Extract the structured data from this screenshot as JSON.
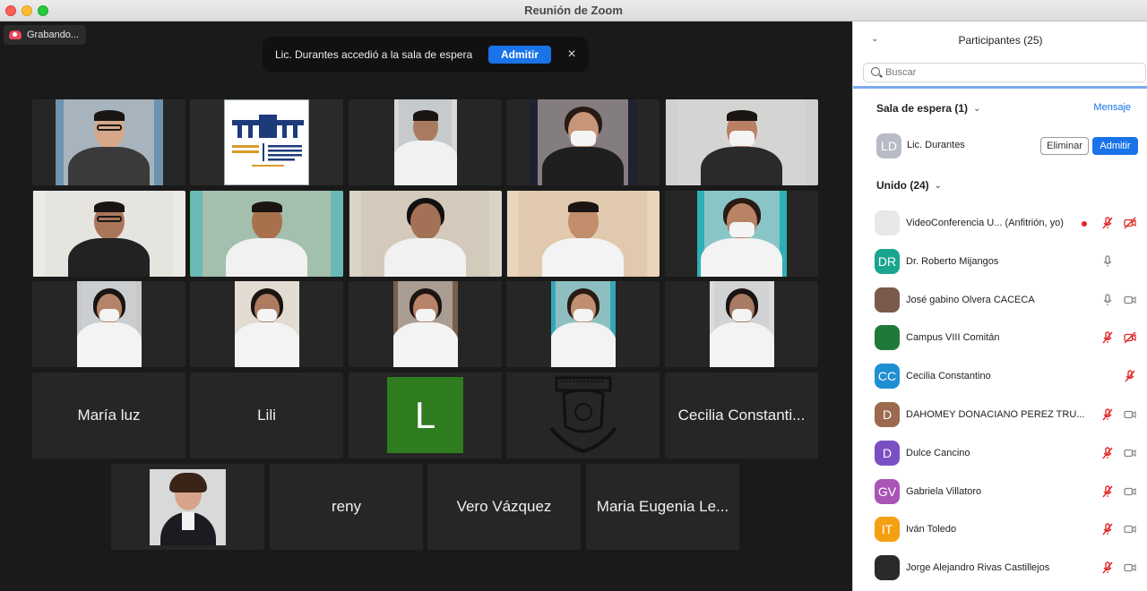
{
  "window": {
    "title": "Reunión de Zoom"
  },
  "recording": {
    "label": "Grabando..."
  },
  "banner": {
    "message": "Lic. Durantes accedió a la sala de espera",
    "admit_label": "Admitir",
    "close_icon": "×"
  },
  "tiles": [
    {
      "kind": "video",
      "label": ""
    },
    {
      "kind": "logo",
      "label": "FACULTAD DE CIENCIAS ADMINISTRATIVAS CAMPUS VIII"
    },
    {
      "kind": "video",
      "label": ""
    },
    {
      "kind": "video",
      "label": ""
    },
    {
      "kind": "video",
      "label": ""
    },
    {
      "kind": "video",
      "label": ""
    },
    {
      "kind": "video",
      "label": "",
      "active": true
    },
    {
      "kind": "video",
      "label": ""
    },
    {
      "kind": "video",
      "label": ""
    },
    {
      "kind": "video",
      "label": ""
    },
    {
      "kind": "video",
      "label": ""
    },
    {
      "kind": "video",
      "label": ""
    },
    {
      "kind": "video",
      "label": ""
    },
    {
      "kind": "video",
      "label": ""
    },
    {
      "kind": "video",
      "label": ""
    },
    {
      "kind": "name",
      "label": "María luz"
    },
    {
      "kind": "name",
      "label": "Lili"
    },
    {
      "kind": "letter",
      "label": "L"
    },
    {
      "kind": "logo2",
      "label": ""
    },
    {
      "kind": "name",
      "label": "Cecilia Constanti..."
    },
    {
      "kind": "photo",
      "label": ""
    },
    {
      "kind": "name",
      "label": "reny"
    },
    {
      "kind": "name",
      "label": "Vero Vázquez"
    },
    {
      "kind": "name",
      "label": "Maria Eugenia Le..."
    }
  ],
  "panel": {
    "title": "Participantes (25)",
    "search_placeholder": "Buscar",
    "waiting_section": "Sala de espera (1)",
    "message_link": "Mensaje",
    "waiting": {
      "initials": "LD",
      "name": "Lic. Durantes",
      "remove_label": "Eliminar",
      "admit_label": "Admitir"
    },
    "joined_section": "Unido (24)",
    "participants": [
      {
        "initials": "",
        "name": "VideoConferencia U... (Anfitrión, yo)",
        "color": "#e8e8e8",
        "mic": "muted",
        "cam": "off",
        "rec": true
      },
      {
        "initials": "DR",
        "name": "Dr. Roberto Mijangos",
        "color": "#1aa58f",
        "mic": "on",
        "cam": "none"
      },
      {
        "initials": "",
        "name": "José gabino Olvera CACECA",
        "color": "#7a5a4a",
        "mic": "on",
        "cam": "on"
      },
      {
        "initials": "",
        "name": "Campus VIII Comitán",
        "color": "#1f7a3a",
        "mic": "muted",
        "cam": "off"
      },
      {
        "initials": "CC",
        "name": "Cecilia Constantino",
        "color": "#1f8fd1",
        "mic": "none",
        "cam": "muted-only"
      },
      {
        "initials": "D",
        "name": "DAHOMEY DONACIANO PEREZ TRU...",
        "color": "#9b6a4f",
        "mic": "muted",
        "cam": "on"
      },
      {
        "initials": "D",
        "name": "Dulce Cancino",
        "color": "#7b4fc4",
        "mic": "muted",
        "cam": "on"
      },
      {
        "initials": "GV",
        "name": "Gabriela Villatoro",
        "color": "#a855b5",
        "mic": "muted",
        "cam": "on"
      },
      {
        "initials": "IT",
        "name": "Iván Toledo",
        "color": "#f5a013",
        "mic": "muted",
        "cam": "on"
      },
      {
        "initials": "",
        "name": "Jorge Alejandro Rivas Castillejos",
        "color": "#2a2a2a",
        "mic": "muted",
        "cam": "on"
      }
    ]
  }
}
